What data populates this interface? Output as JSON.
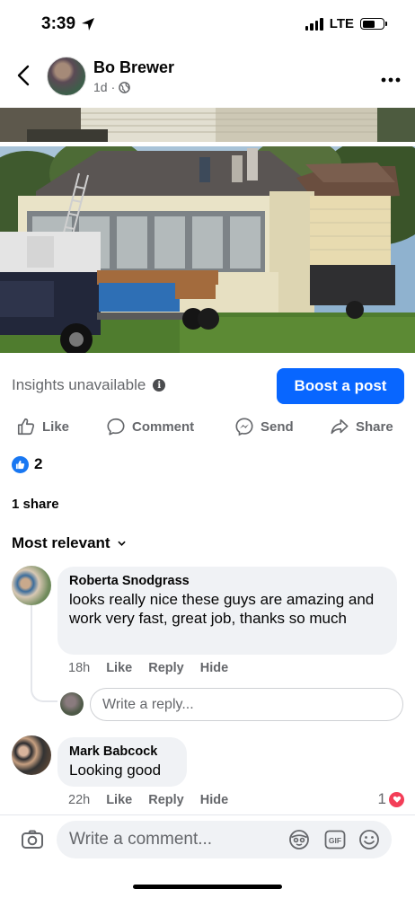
{
  "status_bar": {
    "time": "3:39",
    "network": "LTE"
  },
  "header": {
    "author": "Bo Brewer",
    "age": "1d",
    "separator": "·",
    "icons": [
      "back-chevron-icon",
      "globe-icon",
      "more-dots-icon"
    ]
  },
  "insights": {
    "label": "Insights unavailable",
    "info_icon": "i",
    "boost_label": "Boost a post"
  },
  "actions": {
    "like": "Like",
    "comment": "Comment",
    "send": "Send",
    "share": "Share"
  },
  "reactions": {
    "count": "2",
    "shares": "1 share"
  },
  "comments_header": {
    "sort_label": "Most relevant"
  },
  "comments": [
    {
      "name": "Roberta Snodgrass",
      "text": "looks really nice these guys are amazing and work very fast, great job, thanks so much",
      "time": "18h",
      "like": "Like",
      "reply": "Reply",
      "hide": "Hide"
    },
    {
      "name": "Mark Babcock",
      "text": "Looking good",
      "time": "22h",
      "like": "Like",
      "reply": "Reply",
      "hide": "Hide",
      "reaction_count": "1"
    }
  ],
  "reply_box": {
    "placeholder": "Write a reply..."
  },
  "composer": {
    "placeholder": "Write a comment...",
    "gif_label": "GIF"
  },
  "colors": {
    "accent": "#0866ff",
    "secondary_text": "#65676b",
    "bubble": "#f0f2f5",
    "love": "#f33e58"
  }
}
